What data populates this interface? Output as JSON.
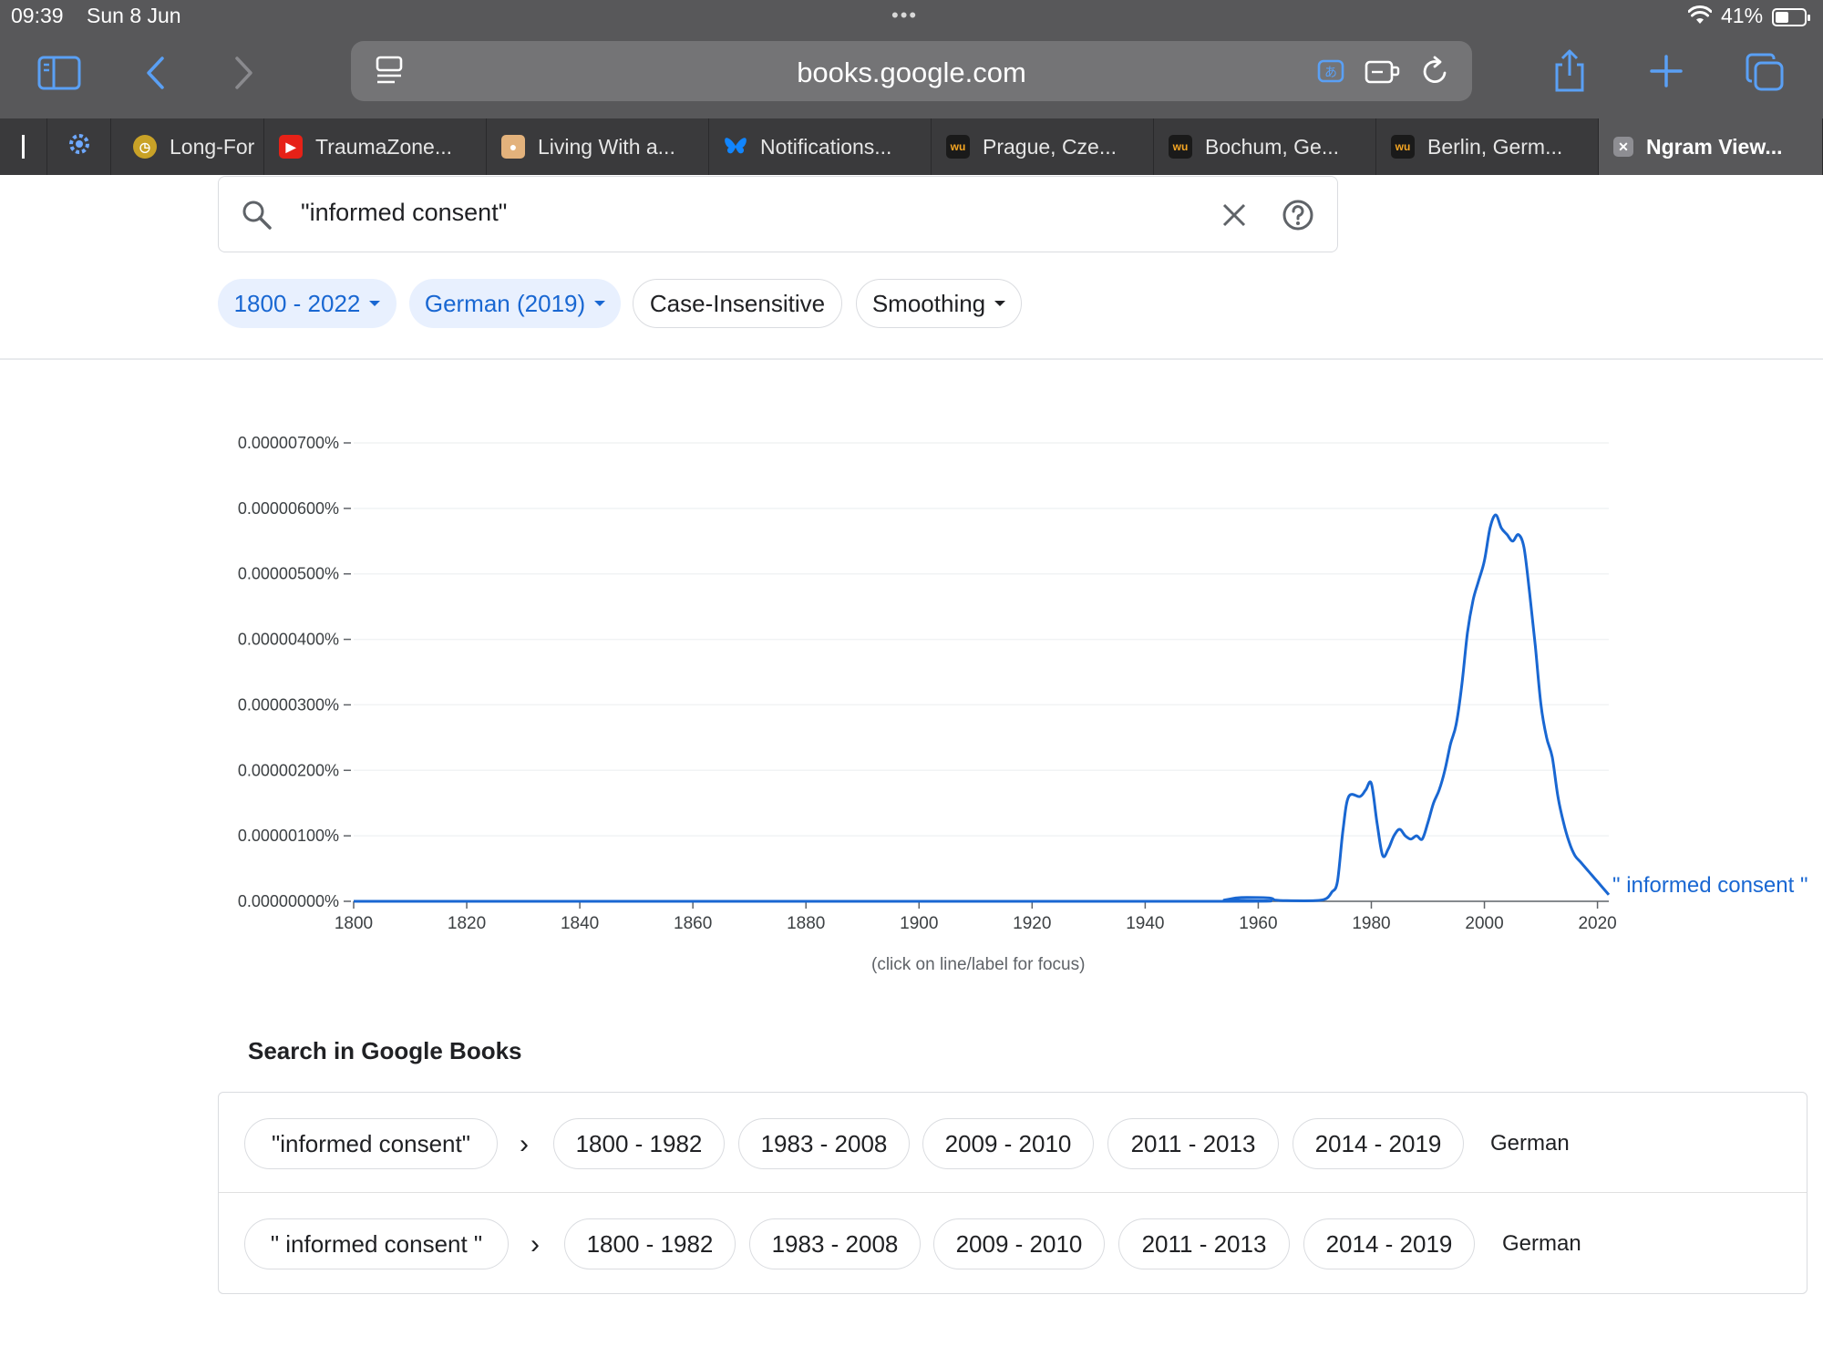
{
  "status": {
    "time": "09:39",
    "date": "Sun 8 Jun",
    "battery": "41%",
    "battery_level": 0.41
  },
  "browser": {
    "url": "books.google.com",
    "icons": [
      "sidebar-icon",
      "back-icon",
      "forward-icon",
      "reader-icon",
      "translate-icon",
      "extension-icon",
      "reload-icon",
      "share-icon",
      "new-tab-icon",
      "tabs-overview-icon"
    ],
    "tabs": [
      {
        "label": "Long-For",
        "icon": "clock-favicon",
        "color": "#c9a227"
      },
      {
        "label": "TraumaZone...",
        "icon": "youtube-favicon",
        "color": "#e62117"
      },
      {
        "label": "Living With a...",
        "icon": "book-favicon",
        "color": "#e08a3c"
      },
      {
        "label": "Notifications...",
        "icon": "bluesky-favicon",
        "color": "#1185fe"
      },
      {
        "label": "Prague, Cze...",
        "icon": "weather-favicon",
        "color": "#1a1a1a"
      },
      {
        "label": "Bochum, Ge...",
        "icon": "weather-favicon",
        "color": "#1a1a1a"
      },
      {
        "label": "Berlin, Germ...",
        "icon": "weather-favicon",
        "color": "#1a1a1a"
      },
      {
        "label": "Ngram View...",
        "icon": "close-favicon",
        "color": "#8e8e93"
      }
    ]
  },
  "search": {
    "query": "\"informed consent\"",
    "chips": {
      "years": "1800 - 2022",
      "corpus": "German (2019)",
      "case": "Case-Insensitive",
      "smoothing": "Smoothing"
    }
  },
  "chart_data": {
    "type": "line",
    "y_ticks": [
      "0.00000000%",
      "0.00000100%",
      "0.00000200%",
      "0.00000300%",
      "0.00000400%",
      "0.00000500%",
      "0.00000600%",
      "0.00000700%"
    ],
    "x_ticks": [
      "1800",
      "1820",
      "1840",
      "1860",
      "1880",
      "1900",
      "1920",
      "1940",
      "1960",
      "1980",
      "2000",
      "2020"
    ],
    "xlim": [
      1800,
      2022
    ],
    "ylim": [
      0,
      7e-06
    ],
    "y_unit": "%",
    "grid": true,
    "color": "#1967d2",
    "series": [
      {
        "name": "\" informed consent \"",
        "x": [
          1800,
          1950,
          1954,
          1956,
          1958,
          1962,
          1963,
          1965,
          1970,
          1972,
          1973,
          1974,
          1975,
          1976,
          1978,
          1979,
          1980,
          1981,
          1982,
          1983,
          1984,
          1985,
          1986,
          1987,
          1988,
          1989,
          1990,
          1991,
          1992,
          1993,
          1994,
          1995,
          1996,
          1997,
          1998,
          1999,
          2000,
          2001,
          2002,
          2003,
          2004,
          2005,
          2006,
          2007,
          2008,
          2009,
          2010,
          2011,
          2012,
          2013,
          2014,
          2015,
          2016,
          2017,
          2018,
          2019,
          2020,
          2021,
          2022
        ],
        "y": [
          0.0,
          0.0,
          2e-08,
          5e-08,
          6e-08,
          5e-08,
          2e-08,
          1e-08,
          1e-08,
          4e-08,
          1.4e-07,
          3e-07,
          1.1e-06,
          1.6e-06,
          1.6e-06,
          1.7e-06,
          1.8e-06,
          1.2e-06,
          7e-07,
          8e-07,
          1e-06,
          1.1e-06,
          1e-06,
          9.5e-07,
          1e-06,
          9.5e-07,
          1.2e-06,
          1.5e-06,
          1.7e-06,
          2e-06,
          2.4e-06,
          2.7e-06,
          3.3e-06,
          4.1e-06,
          4.6e-06,
          4.9e-06,
          5.2e-06,
          5.7e-06,
          5.9e-06,
          5.7e-06,
          5.6e-06,
          5.5e-06,
          5.6e-06,
          5.4e-06,
          4.7e-06,
          3.9e-06,
          3e-06,
          2.5e-06,
          2.2e-06,
          1.6e-06,
          1.2e-06,
          9e-07,
          7e-07,
          6e-07,
          5e-07,
          4e-07,
          3e-07,
          2e-07,
          1e-07
        ]
      }
    ],
    "hint": "(click on line/label for focus)"
  },
  "books": {
    "title": "Search in Google Books",
    "rows": [
      {
        "term": "\"informed consent\"",
        "ranges": [
          "1800 - 1982",
          "1983 - 2008",
          "2009 - 2010",
          "2011 - 2013",
          "2014 - 2019"
        ],
        "lang": "German"
      },
      {
        "term": "\" informed consent \"",
        "ranges": [
          "1800 - 1982",
          "1983 - 2008",
          "2009 - 2010",
          "2011 - 2013",
          "2014 - 2019"
        ],
        "lang": "German"
      }
    ]
  }
}
